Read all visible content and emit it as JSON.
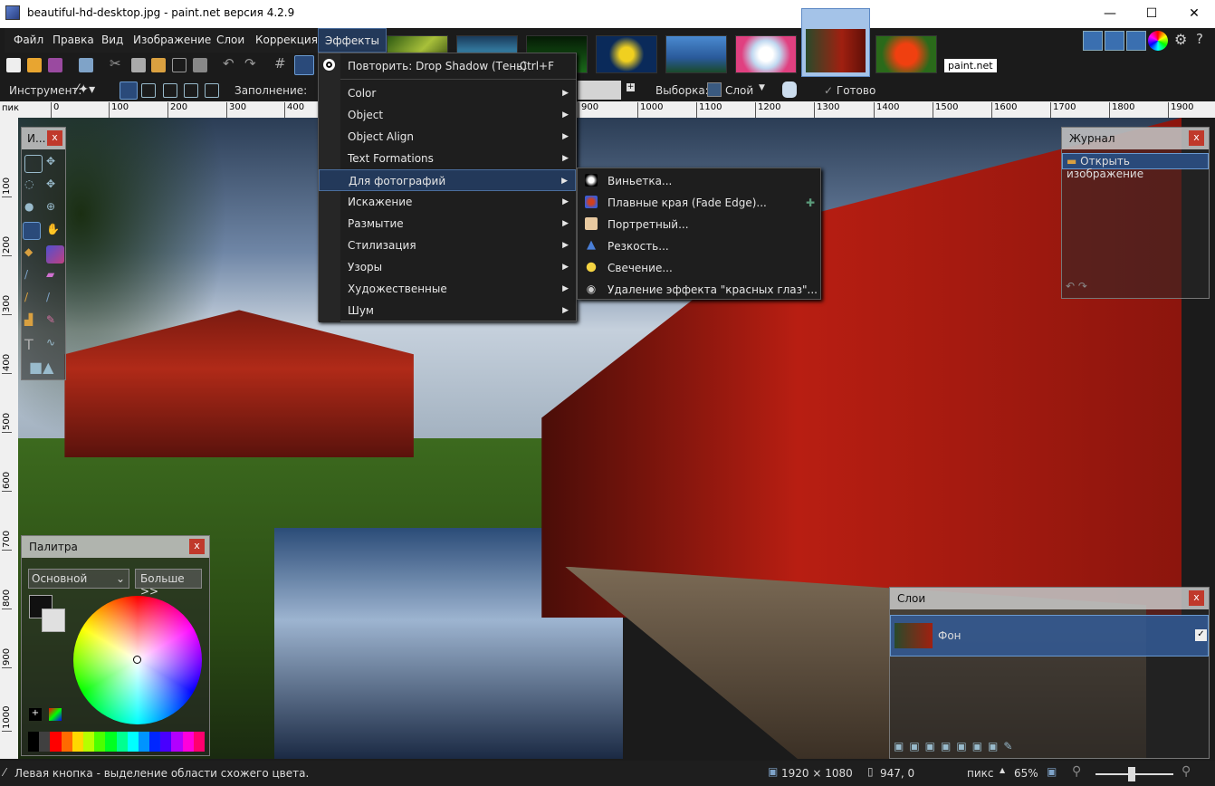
{
  "window": {
    "title": "beautiful-hd-desktop.jpg - paint.net версия 4.2.9",
    "minimize": "—",
    "maximize": "☐",
    "close": "✕"
  },
  "menu": [
    "Файл",
    "Правка",
    "Вид",
    "Изображение",
    "Слои",
    "Коррекция",
    "Эффекты"
  ],
  "thumb_label": "paint.net",
  "tool_options": {
    "tool_label": "Инструмент:",
    "fill_label": "Заполнение:",
    "selection_label": "Выборка:",
    "layer_value": "Слой",
    "done": "Готово"
  },
  "ruler": {
    "corner": "пик",
    "top": [
      "0",
      "100",
      "200",
      "300",
      "400",
      "900",
      "1000",
      "1100",
      "1200",
      "1300",
      "1400",
      "1500",
      "1600",
      "1700",
      "1800",
      "1900"
    ],
    "left": [
      "100",
      "200",
      "300",
      "400",
      "500",
      "600",
      "700",
      "800",
      "900",
      "1000"
    ]
  },
  "effects_menu": {
    "repeat": "Повторить: Drop Shadow (Тень)",
    "repeat_shortcut": "Ctrl+F",
    "items": [
      "Color",
      "Object",
      "Object Align",
      "Text Formations",
      "Для фотографий",
      "Искажение",
      "Размытие",
      "Стилизация",
      "Узоры",
      "Художественные",
      "Шум"
    ],
    "highlighted": "Для фотографий"
  },
  "photo_submenu": {
    "items": [
      {
        "label": "Виньетка...",
        "icon": "vignette-icon",
        "color": "#ffffff"
      },
      {
        "label": "Плавные края (Fade Edge)...",
        "icon": "fade-edge-icon",
        "color": "#3b5bd6"
      },
      {
        "label": "Портретный...",
        "icon": "portrait-icon",
        "color": "#e8c9a0"
      },
      {
        "label": "Резкость...",
        "icon": "sharpen-icon",
        "color": "#4a7fd8"
      },
      {
        "label": "Свечение...",
        "icon": "glow-icon",
        "color": "#f5d442"
      },
      {
        "label": "Удаление эффекта \"красных глаз\"...",
        "icon": "red-eye-icon",
        "color": "#cccccc"
      }
    ]
  },
  "tools_panel": {
    "title": "И..."
  },
  "palette": {
    "title": "Палитра",
    "mode": "Основной",
    "more": "Больше >>"
  },
  "history": {
    "title": "Журнал",
    "items": [
      "Открыть изображение"
    ]
  },
  "layers": {
    "title": "Слои",
    "items": [
      {
        "name": "Фон",
        "visible": true
      }
    ]
  },
  "status": {
    "hint": "Левая кнопка - выделение области схожего цвета.",
    "size": "1920 × 1080",
    "cursor": "947, 0",
    "units": "пикс",
    "zoom": "65%"
  },
  "colors": {
    "accent": "#23395a",
    "primary": "#111111",
    "secondary": "#e0e0e0"
  },
  "palette_colors": [
    "#000000",
    "#404040",
    "#ff0000",
    "#ff6a00",
    "#ffd800",
    "#b6ff00",
    "#4cff00",
    "#00ff21",
    "#00ff90",
    "#00ffff",
    "#0094ff",
    "#0026ff",
    "#4800ff",
    "#b200ff",
    "#ff00dc",
    "#ff006e"
  ]
}
